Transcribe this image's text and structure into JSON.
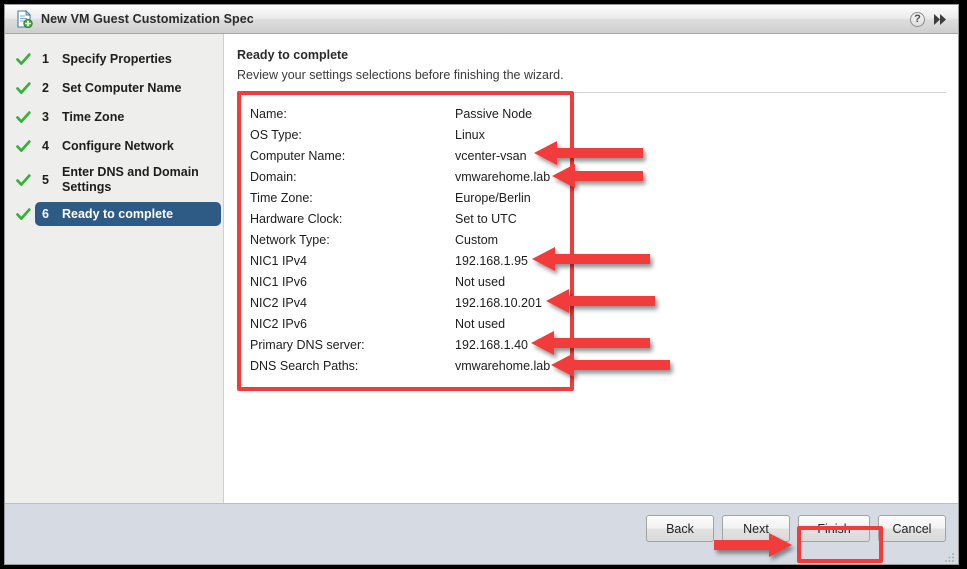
{
  "window": {
    "title": "New VM Guest Customization Spec",
    "icon": "new-document-icon",
    "help_label": "?",
    "advance_label": "▶▶"
  },
  "sidebar": {
    "items": [
      {
        "num": "1",
        "label": "Specify Properties",
        "state": "done"
      },
      {
        "num": "2",
        "label": "Set Computer Name",
        "state": "done"
      },
      {
        "num": "3",
        "label": "Time Zone",
        "state": "done"
      },
      {
        "num": "4",
        "label": "Configure Network",
        "state": "done"
      },
      {
        "num": "5",
        "label": "Enter DNS and Domain Settings",
        "state": "done"
      },
      {
        "num": "6",
        "label": "Ready to complete",
        "state": "current"
      }
    ]
  },
  "content": {
    "title": "Ready to complete",
    "subtitle": "Review your settings selections before finishing the wizard."
  },
  "summary": {
    "rows": [
      {
        "label": "Name:",
        "value": "Passive Node"
      },
      {
        "label": "OS Type:",
        "value": "Linux"
      },
      {
        "label": "Computer Name:",
        "value": "vcenter-vsan"
      },
      {
        "label": "Domain:",
        "value": "vmwarehome.lab"
      },
      {
        "label": "Time Zone:",
        "value": "Europe/Berlin"
      },
      {
        "label": "Hardware Clock:",
        "value": "Set to UTC"
      },
      {
        "label": "Network Type:",
        "value": "Custom"
      },
      {
        "label": "NIC1 IPv4",
        "value": "192.168.1.95"
      },
      {
        "label": "NIC1 IPv6",
        "value": "Not used"
      },
      {
        "label": "NIC2 IPv4",
        "value": "192.168.10.201"
      },
      {
        "label": "NIC2 IPv6",
        "value": "Not used"
      },
      {
        "label": "Primary DNS server:",
        "value": "192.168.1.40"
      },
      {
        "label": "DNS Search Paths:",
        "value": "vmwarehome.lab"
      }
    ]
  },
  "footer": {
    "back_label": "Back",
    "next_label": "Next",
    "finish_label": "Finish",
    "cancel_label": "Cancel"
  },
  "annotations": {
    "accent_color": "#f23b3b",
    "highlight_color": "#2e5a86",
    "check_color": "#34b233",
    "boxes": [
      {
        "name": "summary-highlight-box"
      },
      {
        "name": "finish-highlight-box"
      }
    ],
    "arrows": [
      {
        "name": "arrow-computer-name",
        "points_to": "vcenter-vsan"
      },
      {
        "name": "arrow-domain",
        "points_to": "vmwarehome.lab"
      },
      {
        "name": "arrow-nic1-ipv4",
        "points_to": "192.168.1.95"
      },
      {
        "name": "arrow-nic2-ipv4",
        "points_to": "192.168.10.201"
      },
      {
        "name": "arrow-primary-dns",
        "points_to": "192.168.1.40"
      },
      {
        "name": "arrow-dns-search-paths",
        "points_to": "vmwarehome.lab"
      },
      {
        "name": "arrow-finish-button",
        "points_to": "Finish"
      }
    ]
  }
}
